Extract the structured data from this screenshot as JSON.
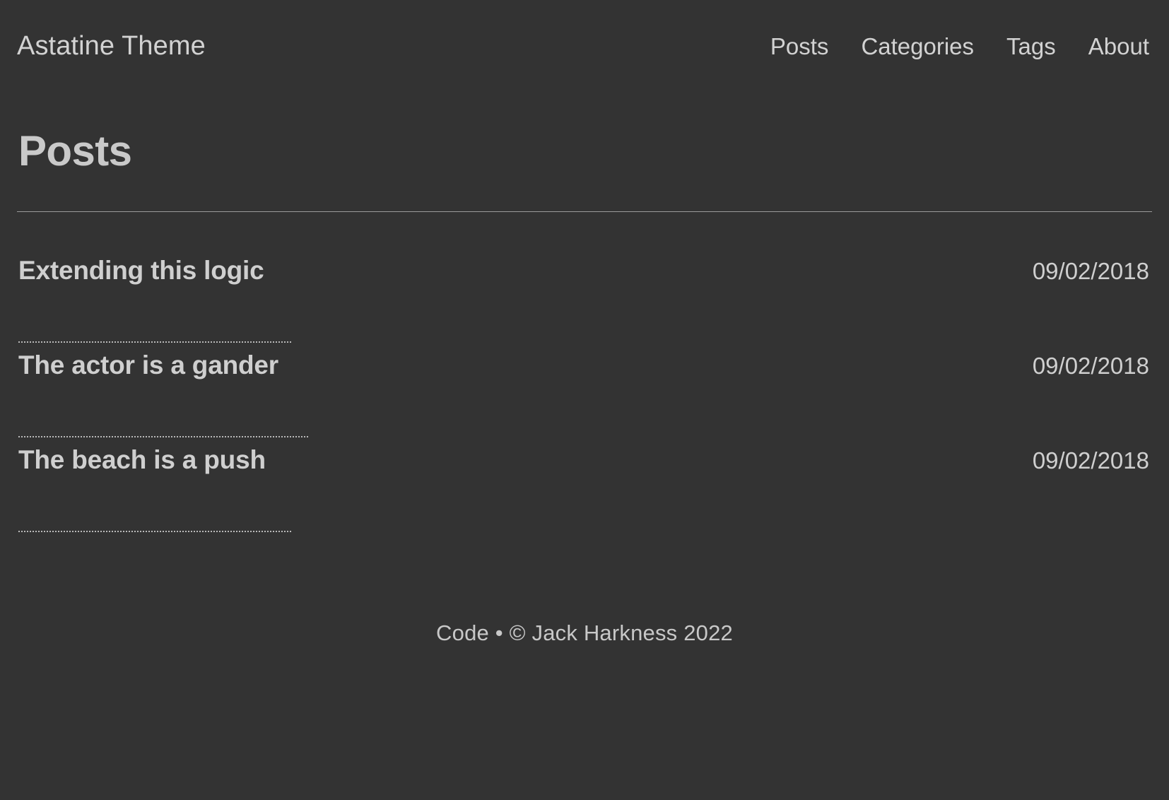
{
  "theme": {
    "background": "#333333",
    "text": "#d2d2d2",
    "rule": "#9b9b9b",
    "dotted": "#b9b9b9"
  },
  "header": {
    "site_title": "Astatine Theme",
    "nav": [
      {
        "label": "Posts"
      },
      {
        "label": "Categories"
      },
      {
        "label": "Tags"
      },
      {
        "label": "About"
      }
    ]
  },
  "main": {
    "page_title": "Posts",
    "posts": [
      {
        "title": "Extending this logic",
        "date": "09/02/2018"
      },
      {
        "title": "The actor is a gander",
        "date": "09/02/2018"
      },
      {
        "title": "The beach is a push",
        "date": "09/02/2018"
      }
    ]
  },
  "footer": {
    "code_label": "Code",
    "separator": "•",
    "copyright": "© Jack Harkness 2022",
    "full_text": "Code • © Jack Harkness 2022"
  }
}
